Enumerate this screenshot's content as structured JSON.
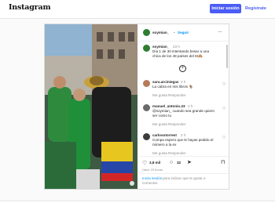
{
  "topbar": {
    "logo": "Instagram",
    "login": "Iniciar sesión",
    "signup": "Regístrate"
  },
  "post": {
    "username": "soymian_",
    "dot": "•",
    "follow": "Seguir",
    "more": "···",
    "caption": {
      "username": "soymian_",
      "time": "23 h",
      "text_line1": "Día 1 de 30 intentando besar a una",
      "text_line2": "chica de los 48 países del M🙈"
    },
    "comments": [
      {
        "username": "sara.arciniegas",
        "time": "2 h",
        "text1": "La cabra en mis libros 🐐",
        "text2": "",
        "likes": "Me gusta",
        "reply": "Responder"
      },
      {
        "username": "manuel_antonio.23",
        "time": "2 h",
        "text1": "@soymian_ cuando sea grande quiero",
        "text2": "ser como tu",
        "likes": "Me gusta",
        "reply": "Responder"
      },
      {
        "username": "carlosotorrest",
        "time": "2 h",
        "text1": "Compa espero que le hayas pedido el",
        "text2": "número a la ex",
        "likes": "Me gusta",
        "reply": "Responder"
      }
    ],
    "like_count": "3,8 mil",
    "comment_count": "32",
    "posted": "Hace 23 horas",
    "login_prompt_link": "Inicia sesión",
    "login_prompt_text": "para indicar que te gusta o",
    "login_prompt_text2": "comentar."
  }
}
